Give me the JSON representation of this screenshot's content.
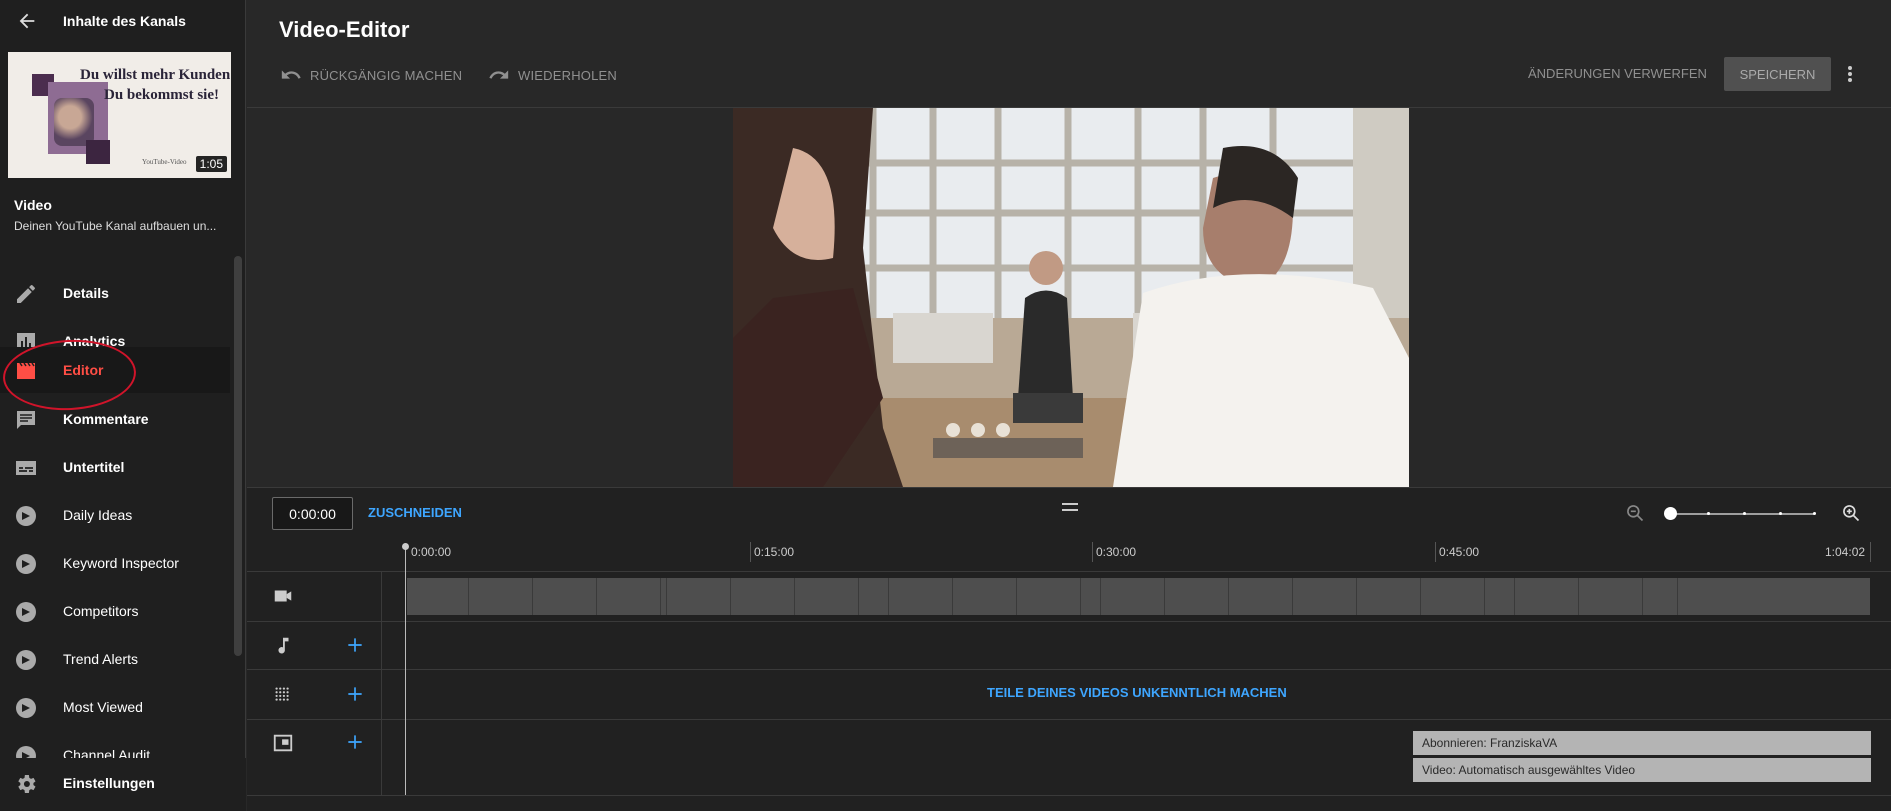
{
  "sidebar": {
    "back_label": "Inhalte des Kanals",
    "thumbnail": {
      "line1": "Du willst mehr Kunden?",
      "line2": "Du bekommst sie!",
      "small_text": "YouTube-Video",
      "duration": "1:05"
    },
    "video_title": "Video",
    "video_subtitle": "Deinen YouTube Kanal aufbauen un...",
    "items": [
      {
        "label": "Details",
        "icon": "pencil-icon"
      },
      {
        "label": "Analytics",
        "icon": "analytics-icon"
      },
      {
        "label": "Editor",
        "icon": "clapperboard-icon",
        "active": true
      },
      {
        "label": "Kommentare",
        "icon": "comment-icon"
      },
      {
        "label": "Untertitel",
        "icon": "subtitles-icon"
      },
      {
        "label": "Daily Ideas",
        "icon": "vidiq-icon"
      },
      {
        "label": "Keyword Inspector",
        "icon": "vidiq-icon"
      },
      {
        "label": "Competitors",
        "icon": "vidiq-icon"
      },
      {
        "label": "Trend Alerts",
        "icon": "vidiq-icon"
      },
      {
        "label": "Most Viewed",
        "icon": "vidiq-icon"
      },
      {
        "label": "Channel Audit",
        "icon": "vidiq-icon"
      }
    ],
    "settings_label": "Einstellungen"
  },
  "header": {
    "title": "Video-Editor",
    "undo_label": "RÜCKGÄNGIG MACHEN",
    "redo_label": "WIEDERHOLEN",
    "discard_label": "ÄNDERUNGEN VERWERFEN",
    "save_label": "SPEICHERN"
  },
  "timeline": {
    "current_time": "0:00:00",
    "trim_label": "ZUSCHNEIDEN",
    "ruler": [
      "0:00:00",
      "0:15:00",
      "0:30:00",
      "0:45:00",
      "1:04:02"
    ],
    "blur_label": "TEILE DEINES VIDEOS UNKENNTLICH MACHEN",
    "endscreen_items": [
      "Abonnieren: FranziskaVA",
      "Video: Automatisch ausgewähltes Video"
    ]
  },
  "colors": {
    "accent_blue": "#3ea6ff",
    "active_red": "#ff4e45",
    "background": "#282828"
  }
}
